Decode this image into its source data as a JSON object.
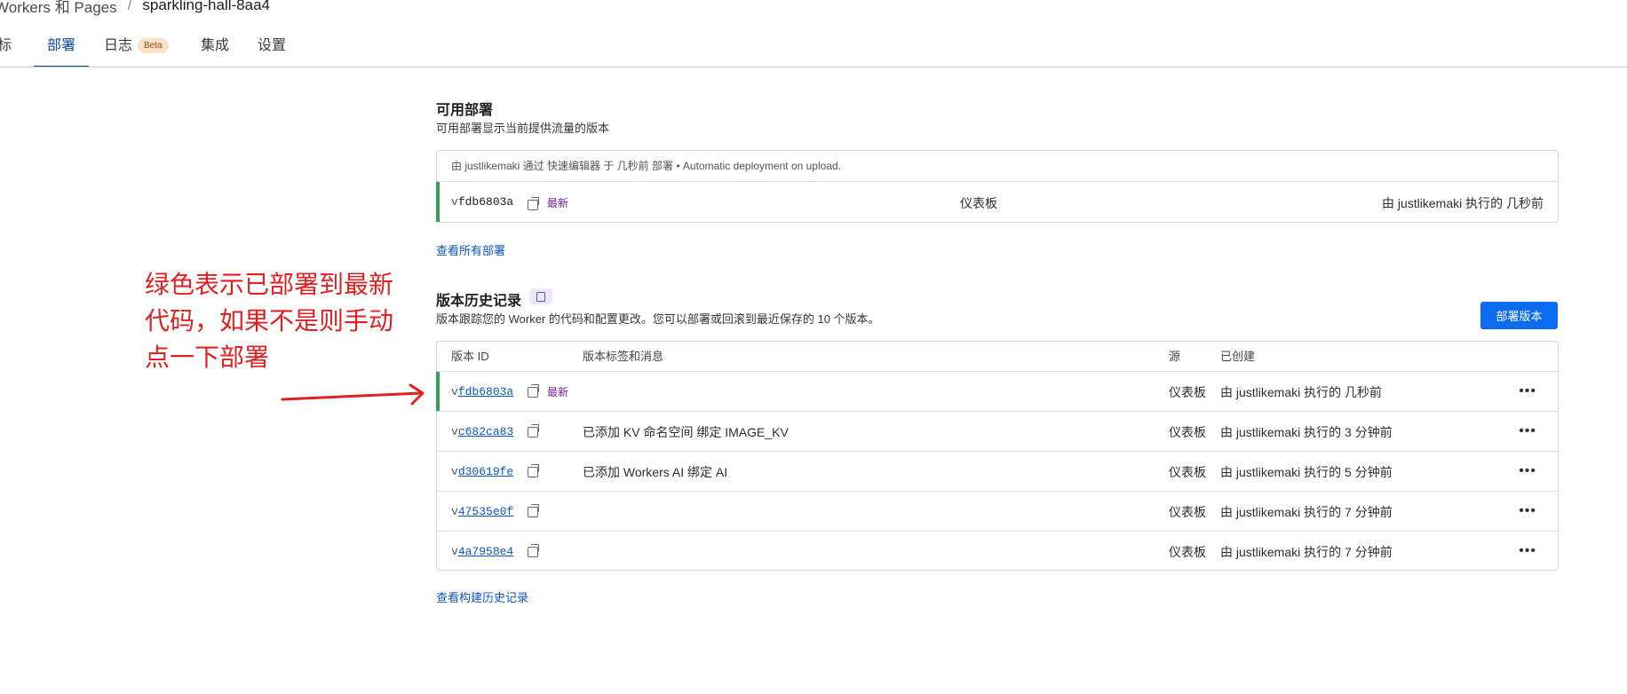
{
  "breadcrumb": {
    "parent": "Workers 和 Pages",
    "separator": "/",
    "current": "sparkling-hall-8aa4"
  },
  "tabs": [
    {
      "label": "指标"
    },
    {
      "label": "部署",
      "active": true
    },
    {
      "label": "日志",
      "badge": "Beta"
    },
    {
      "label": "集成"
    },
    {
      "label": "设置"
    }
  ],
  "active_deployments": {
    "title": "可用部署",
    "subtitle": "可用部署显示当前提供流量的版本",
    "meta": "由 justlikemaki 通过 快速编辑器 于 几秒前 部署 • Automatic deployment on upload.",
    "row": {
      "version_prefix": "v",
      "version_hash": "fdb6803a",
      "latest_label": "最新",
      "source": "仪表板",
      "created_by": "由 justlikemaki 执行的 几秒前"
    },
    "view_all_link": "查看所有部署"
  },
  "version_history": {
    "title": "版本历史记录",
    "subtitle": "版本跟踪您的 Worker 的代码和配置更改。您可以部署或回滚到最近保存的 10 个版本。",
    "deploy_button": "部署版本",
    "columns": {
      "version_id": "版本 ID",
      "tags_messages": "版本标签和消息",
      "source": "源",
      "created": "已创建"
    },
    "rows": [
      {
        "prefix": "v",
        "hash": "fdb6803a",
        "latest": "最新",
        "message": "",
        "source": "仪表板",
        "created": "由 justlikemaki 执行的 几秒前",
        "menu": "•••"
      },
      {
        "prefix": "v",
        "hash": "c682ca83",
        "latest": "",
        "message": "已添加 KV 命名空间 绑定 IMAGE_KV",
        "source": "仪表板",
        "created": "由 justlikemaki 执行的 3 分钟前",
        "menu": "•••"
      },
      {
        "prefix": "v",
        "hash": "d30619fe",
        "latest": "",
        "message": "已添加 Workers AI 绑定 AI",
        "source": "仪表板",
        "created": "由 justlikemaki 执行的 5 分钟前",
        "menu": "•••"
      },
      {
        "prefix": "v",
        "hash": "47535e0f",
        "latest": "",
        "message": "",
        "source": "仪表板",
        "created": "由 justlikemaki 执行的 7 分钟前",
        "menu": "•••"
      },
      {
        "prefix": "v",
        "hash": "4a7958e4",
        "latest": "",
        "message": "",
        "source": "仪表板",
        "created": "由 justlikemaki 执行的 7 分钟前",
        "menu": "•••"
      }
    ],
    "view_builds_link": "查看构建历史记录"
  },
  "annotation": {
    "text": "绿色表示已部署到最新代码，如果不是则手动点一下部署",
    "color": "#e02121"
  },
  "colors": {
    "accent": "#0b6cf0",
    "active_green": "#2ea44f",
    "link": "#0b55c4",
    "latest_purple": "#7b1fa2"
  }
}
